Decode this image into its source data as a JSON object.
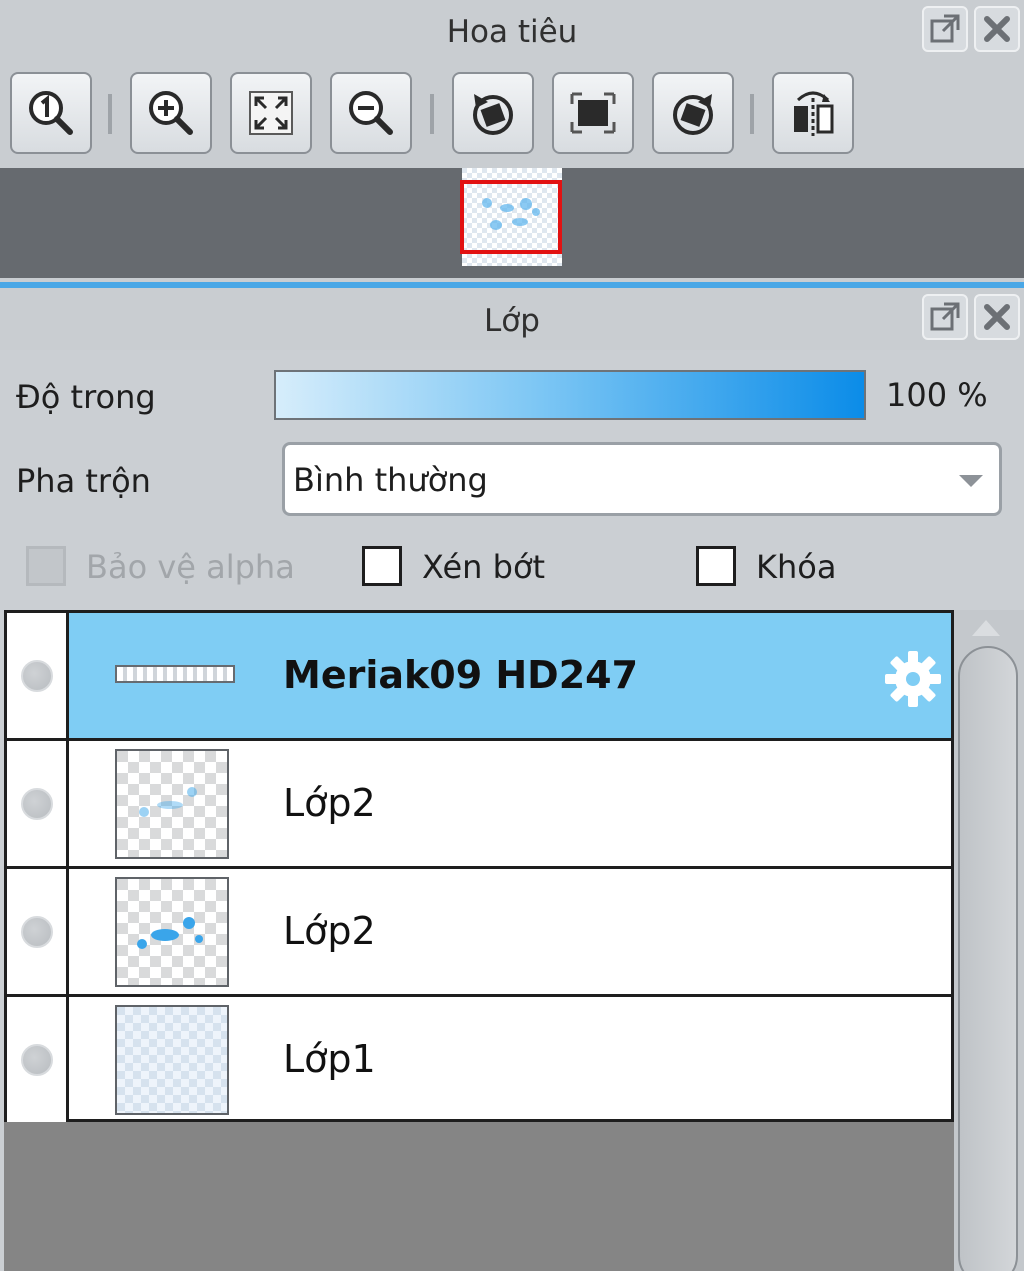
{
  "navigator": {
    "title": "Hoa tiêu",
    "toolbar": [
      {
        "icon": "zoom-actual-size-icon"
      },
      {
        "icon": "zoom-in-icon"
      },
      {
        "icon": "fit-to-window-icon"
      },
      {
        "icon": "zoom-out-icon"
      },
      {
        "icon": "rotate-left-icon"
      },
      {
        "icon": "reset-rotation-icon"
      },
      {
        "icon": "rotate-right-icon"
      },
      {
        "icon": "flip-horizontal-icon"
      }
    ]
  },
  "layers_panel": {
    "title": "Lớp",
    "opacity_label": "Độ trong",
    "opacity_value": "100 %",
    "opacity_fraction": 1.0,
    "blend_label": "Pha trộn",
    "blend_value": "Bình thường",
    "checkboxes": {
      "protect_alpha": {
        "label": "Bảo vệ alpha",
        "checked": false,
        "enabled": false
      },
      "clipping": {
        "label": "Xén bớt",
        "checked": false,
        "enabled": true
      },
      "lock": {
        "label": "Khóa",
        "checked": false,
        "enabled": true
      }
    },
    "layers": [
      {
        "name": "Meriak09 HD247",
        "selected": true,
        "type": "text"
      },
      {
        "name": "Lớp2",
        "selected": false,
        "type": "raster"
      },
      {
        "name": "Lớp2",
        "selected": false,
        "type": "raster"
      },
      {
        "name": "Lớp1",
        "selected": false,
        "type": "raster"
      }
    ]
  },
  "colors": {
    "selected_row": "#7fcdf4",
    "accent": "#0b8ce8",
    "navigator_view_frame": "#e21212"
  }
}
